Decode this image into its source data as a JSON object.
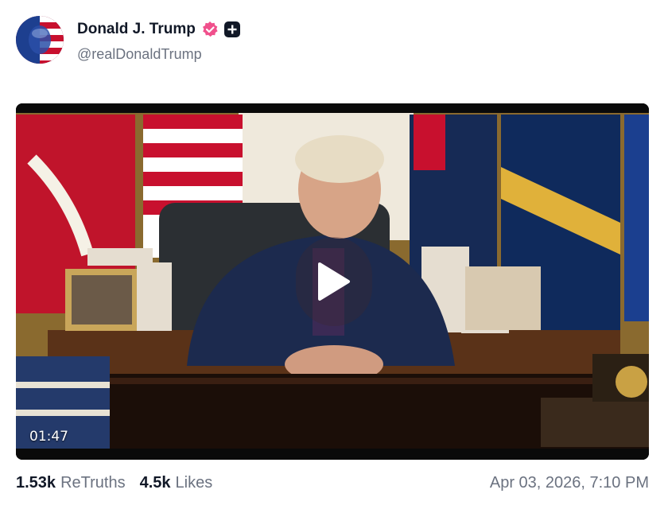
{
  "post": {
    "author_name": "Donald J. Trump",
    "author_handle": "@realDonaldTrump",
    "video_duration": "01:47",
    "retruths_count": "1.53k",
    "retruths_label": "ReTruths",
    "likes_count": "4.5k",
    "likes_label": "Likes",
    "timestamp": "Apr 03, 2026, 7:10 PM"
  },
  "icons": {
    "verified": "verified-badge-icon",
    "plus": "plus-icon",
    "play": "play-icon"
  },
  "colors": {
    "verified_badge": "#f0508c",
    "text_primary": "#111827",
    "text_secondary": "#6b7280"
  }
}
